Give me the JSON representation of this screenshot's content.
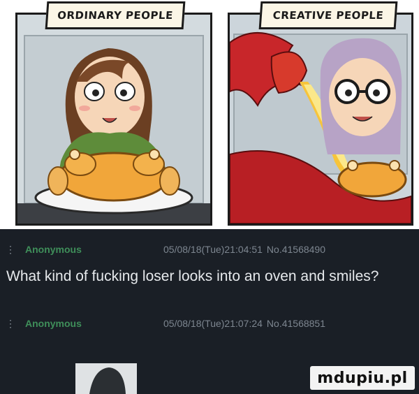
{
  "comic": {
    "left_caption": "ORDINARY PEOPLE",
    "right_caption": "CREATIVE PEOPLE"
  },
  "post1": {
    "name": "Anonymous",
    "datetime": "05/08/18(Tue)21:04:51",
    "number": "No.41568490",
    "text": "What kind of fucking loser looks into an oven and smiles?"
  },
  "post2": {
    "name": "Anonymous",
    "datetime": "05/08/18(Tue)21:07:24",
    "number": "No.41568851"
  },
  "watermark": "mdupiu.pl",
  "colors": {
    "page_bg": "#1a1f26",
    "name_green": "#3f8f5a",
    "dragon_red": "#c8262a"
  }
}
